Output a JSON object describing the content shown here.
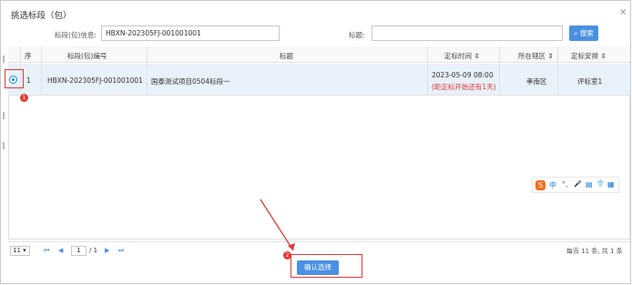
{
  "dialog": {
    "title": "挑选标段（包）",
    "close": "×"
  },
  "filter": {
    "bid_label": "标段(包)信息:",
    "bid_value": "HBXN-202305FJ-001001001",
    "title_label": "标题:",
    "title_value": "",
    "search_button": "搜索"
  },
  "table": {
    "columns": [
      "序",
      "标段(包)编号",
      "标题",
      "定标时间 ⇕",
      "所在辖区 ⇕",
      "定标安排 ⇕"
    ],
    "rows": [
      {
        "index": "1",
        "code": "HBXN-202305FJ-001001001",
        "title": "国泰测试项目0504标段一",
        "time": "2023-05-09 08:00",
        "time_note": "(距定标开始还有1天)",
        "district": "孝南区",
        "arrangement": "评标室1"
      }
    ]
  },
  "pager": {
    "page_size": "11",
    "current_page": "1",
    "total_pages": "/ 1",
    "summary": "每页 11 条, 共 1 条"
  },
  "confirm_button": "确认选择",
  "annotations": {
    "badge1": "1",
    "badge2": "2"
  },
  "ime": {
    "logo": "S",
    "items": [
      "中",
      "°,",
      "🎤",
      "▤",
      "👕",
      "▦"
    ]
  },
  "colors": {
    "accent": "#4a90e2",
    "highlight_row": "#e9f1fb",
    "warning": "#e53935"
  }
}
